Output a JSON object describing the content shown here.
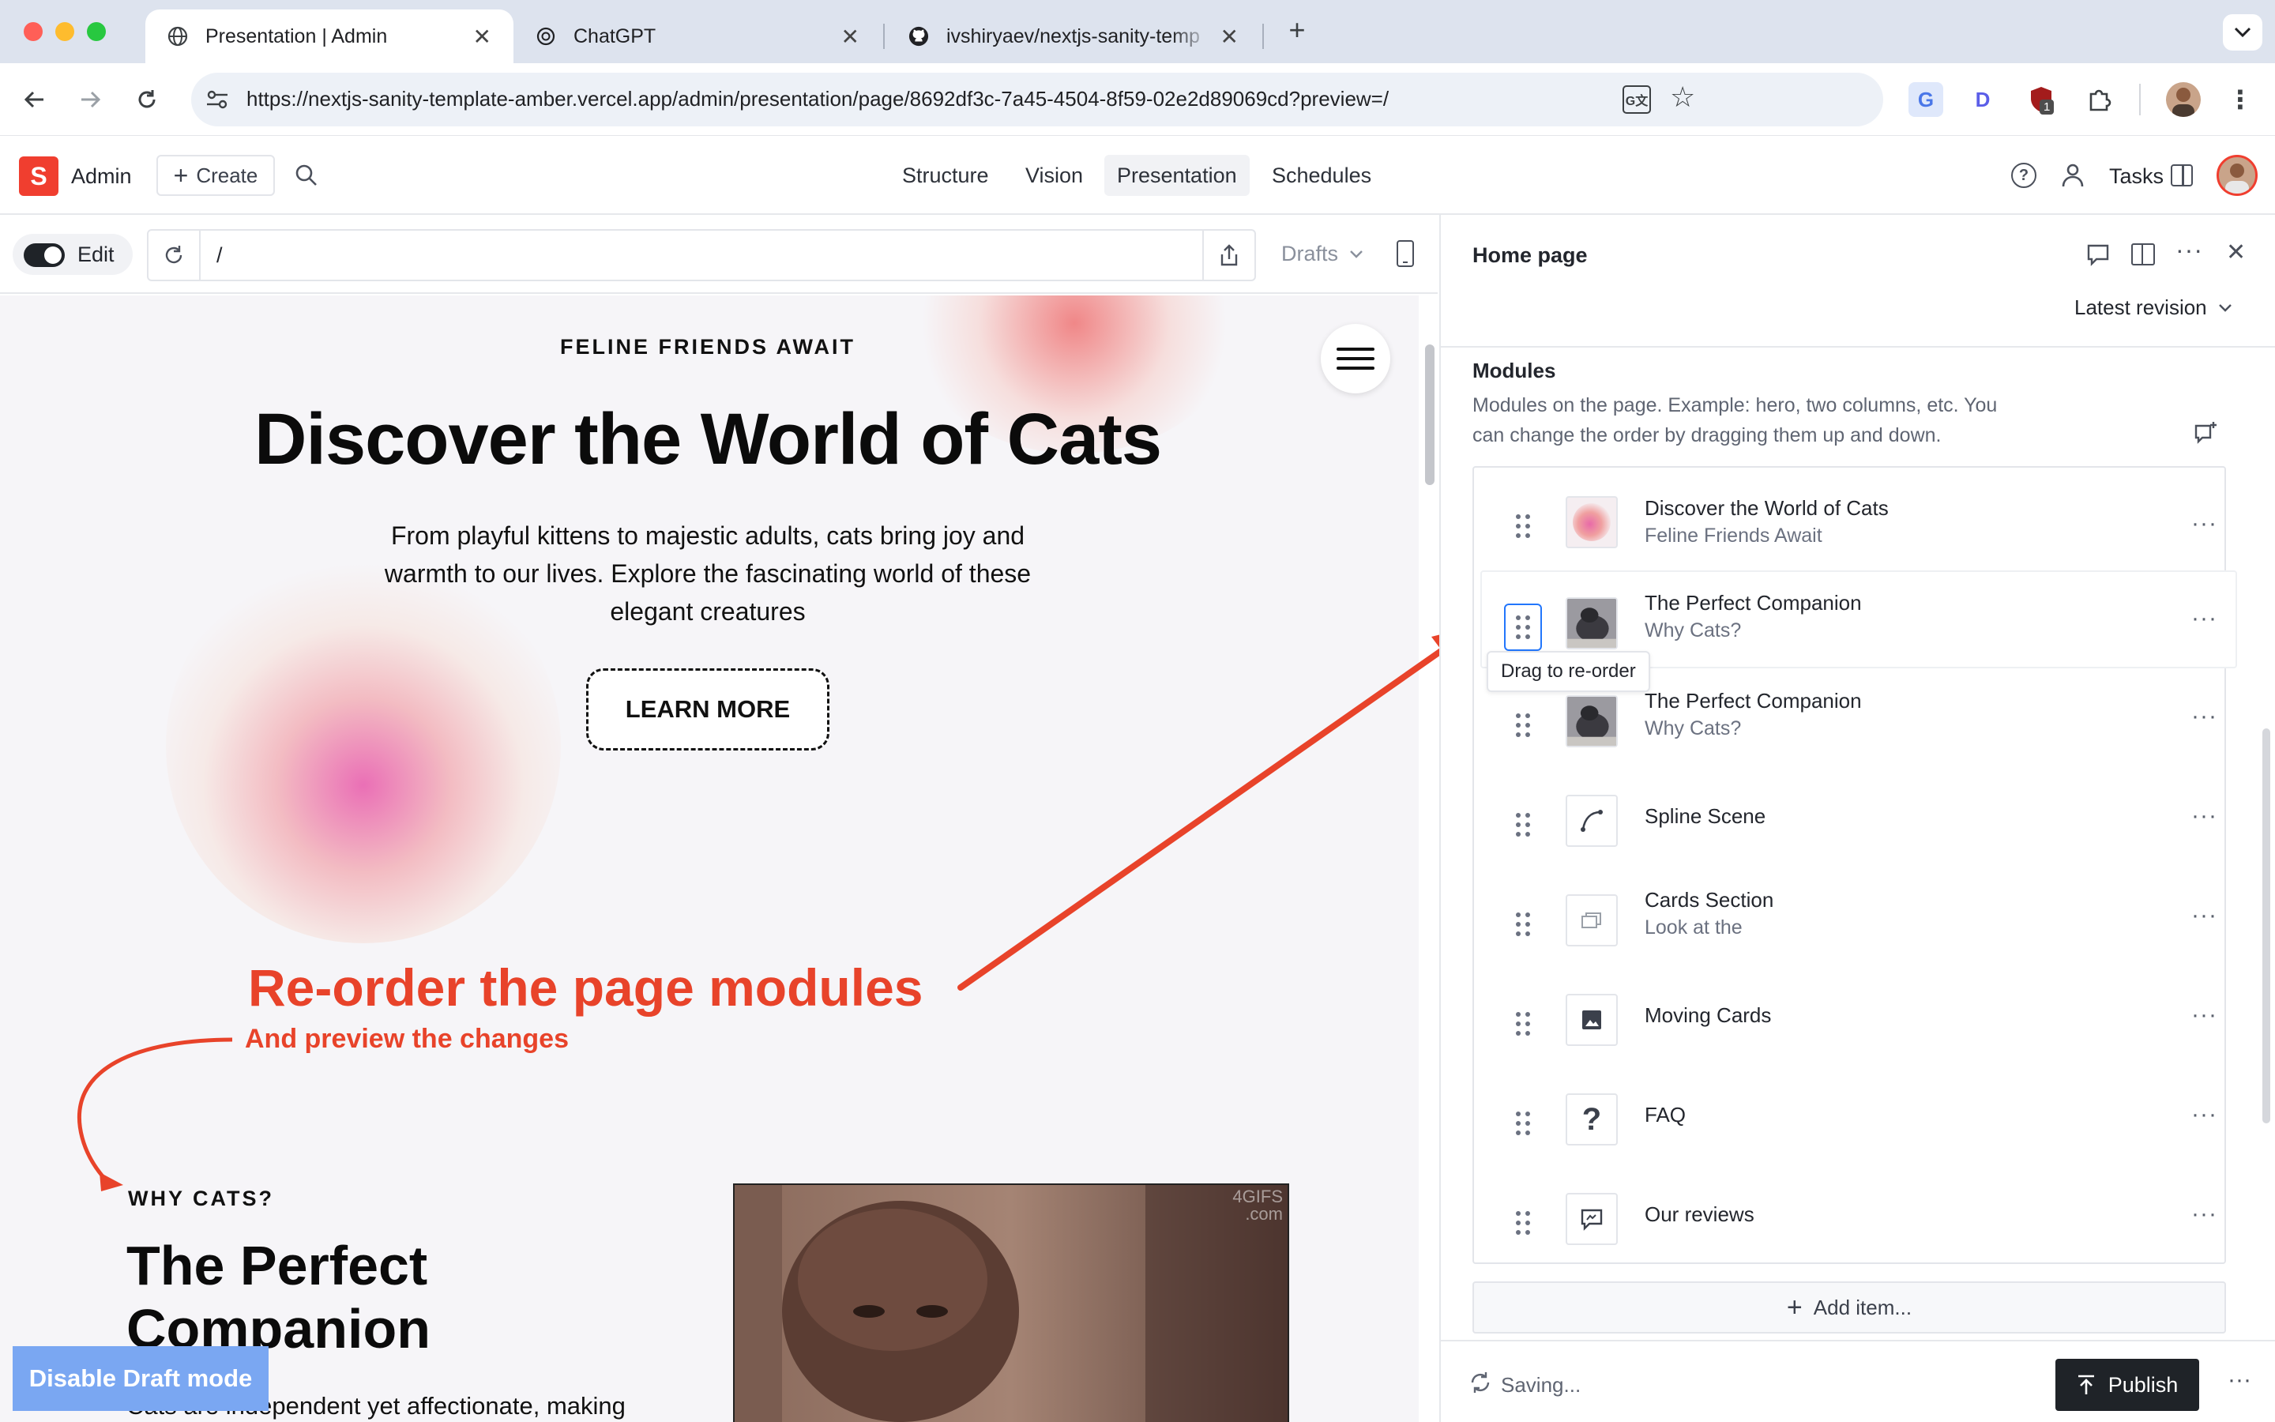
{
  "browser": {
    "tabs": [
      {
        "title": "Presentation | Admin",
        "icon": "globe-icon",
        "active": true
      },
      {
        "title": "ChatGPT",
        "icon": "chatgpt-icon",
        "active": false
      },
      {
        "title": "ivshiryaev/nextjs-sanity-temp",
        "icon": "github-icon",
        "active": false
      }
    ],
    "url": "https://nextjs-sanity-template-amber.vercel.app/admin/presentation/page/8692df3c-7a45-4504-8f59-02e2d89069cd?preview=/",
    "extension_badge": "1"
  },
  "studio": {
    "logo_letter": "S",
    "workspace": "Admin",
    "create_label": "Create",
    "nav": [
      {
        "label": "Structure",
        "active": false
      },
      {
        "label": "Vision",
        "active": false
      },
      {
        "label": "Presentation",
        "active": true
      },
      {
        "label": "Schedules",
        "active": false
      }
    ],
    "tasks_label": "Tasks"
  },
  "preview_toolbar": {
    "edit_label": "Edit",
    "path": "/",
    "perspective": "Drafts"
  },
  "preview": {
    "hero": {
      "eyebrow": "FELINE FRIENDS AWAIT",
      "title": "Discover the World of Cats",
      "body_lines": [
        "From playful kittens to majestic adults, cats bring joy and",
        "warmth to our lives. Explore the fascinating world of these",
        "elegant creatures"
      ],
      "cta": "LEARN MORE"
    },
    "annotation": {
      "headline": "Re-order the page modules",
      "subline": "And preview the changes",
      "color": "#e8432a"
    },
    "section2": {
      "eyebrow": "WHY CATS?",
      "title_lines": [
        "The Perfect",
        "Companion"
      ],
      "body_partial": "Cats are independent yet affectionate, making",
      "gif_watermark": "4GIFS\n.com"
    },
    "draft_button": "Disable Draft mode"
  },
  "document": {
    "title": "Home page",
    "revision": "Latest revision",
    "field_label": "Modules",
    "field_description_lines": [
      "Modules on the page. Example: hero, two columns, etc. You",
      "can change the order by dragging them up and down."
    ],
    "modules": [
      {
        "title": "Discover the World of Cats",
        "subtitle": "Feline Friends Await",
        "thumb": "gradient-blob-thumb"
      },
      {
        "title": "The Perfect Companion",
        "subtitle": "Why Cats?",
        "thumb": "photo-thumb"
      },
      {
        "title": "The Perfect Companion",
        "subtitle": "Why Cats?",
        "thumb": "photo-thumb"
      },
      {
        "title": "Spline Scene",
        "subtitle": "",
        "thumb": "spline-icon"
      },
      {
        "title": "Cards Section",
        "subtitle": "Look at the",
        "thumb": "cards-icon"
      },
      {
        "title": "Moving Cards",
        "subtitle": "",
        "thumb": "image-icon"
      },
      {
        "title": "FAQ",
        "subtitle": "",
        "thumb": "question-icon"
      },
      {
        "title": "Our reviews",
        "subtitle": "",
        "thumb": "comment-icon"
      }
    ],
    "tooltip": "Drag to re-order",
    "add_item": "Add item...",
    "status": "Saving...",
    "publish": "Publish"
  }
}
